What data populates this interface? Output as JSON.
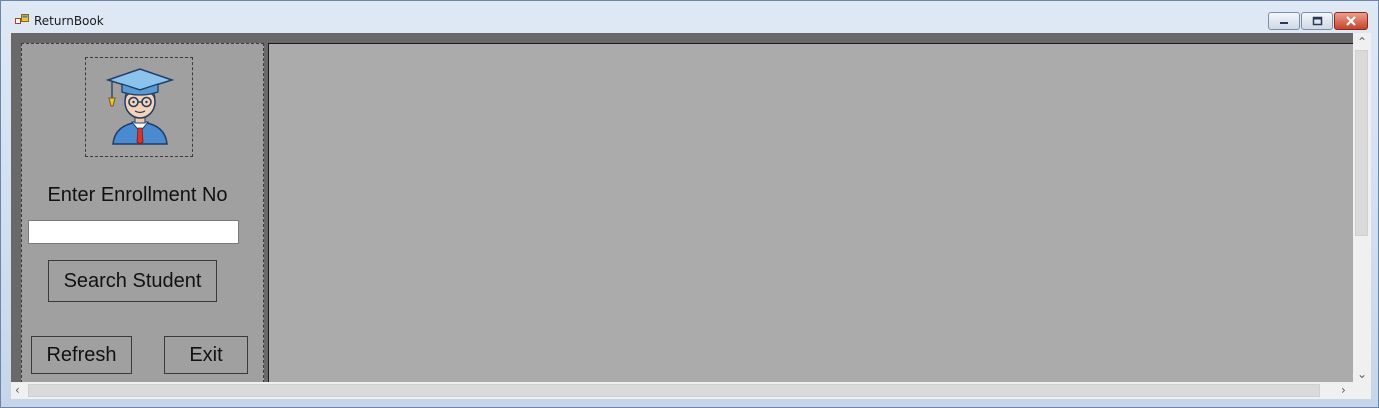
{
  "window": {
    "title": "ReturnBook"
  },
  "sidebar": {
    "enroll_label": "Enter Enrollment No",
    "enroll_value": "",
    "search_label": "Search Student",
    "refresh_label": "Refresh",
    "exit_label": "Exit"
  },
  "icons": {
    "app": "app-icon",
    "student": "student-graduate-icon"
  },
  "colors": {
    "panel_bg": "#a0a0a0",
    "main_bg": "#ababab",
    "client_bg": "#696969"
  }
}
